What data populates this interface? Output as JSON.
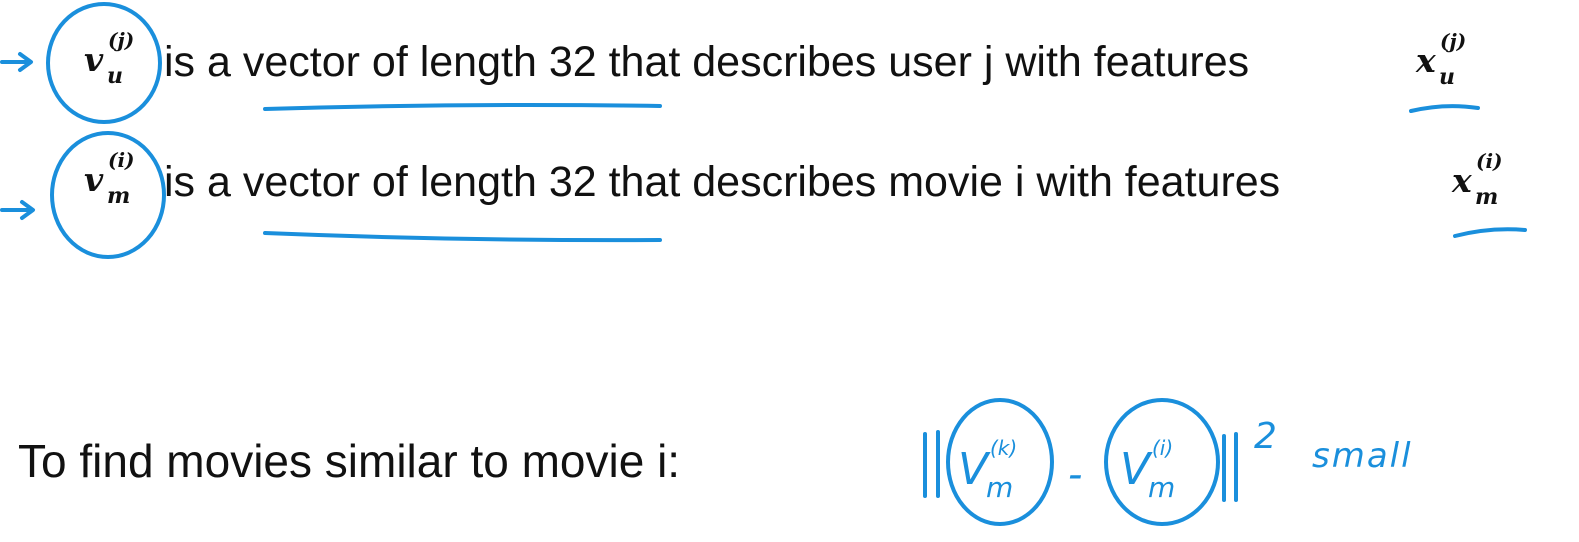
{
  "line1": {
    "var_base": "v",
    "var_sub": "u",
    "var_sup": "(j)",
    "text": "is a vector of length 32 that describes user j with features",
    "feat_base": "x",
    "feat_sub": "u",
    "feat_sup": "(j)"
  },
  "line2": {
    "var_base": "v",
    "var_sub": "m",
    "var_sup": "(i)",
    "text": "is a vector of length 32 that describes movie i with features",
    "feat_base": "x",
    "feat_sub": "m",
    "feat_sup": "(i)"
  },
  "bottom": {
    "text": "To find movies similar to movie i:"
  },
  "handwriting": {
    "v1_base": "V",
    "v1_sub": "m",
    "v1_sup": "(k)",
    "minus": "-",
    "v2_base": "V",
    "v2_sub": "m",
    "v2_sup": "(i)",
    "exponent": "2",
    "note": "small"
  },
  "colors": {
    "ink": "#1a8fdc",
    "text": "#111111",
    "background": "#ffffff"
  }
}
